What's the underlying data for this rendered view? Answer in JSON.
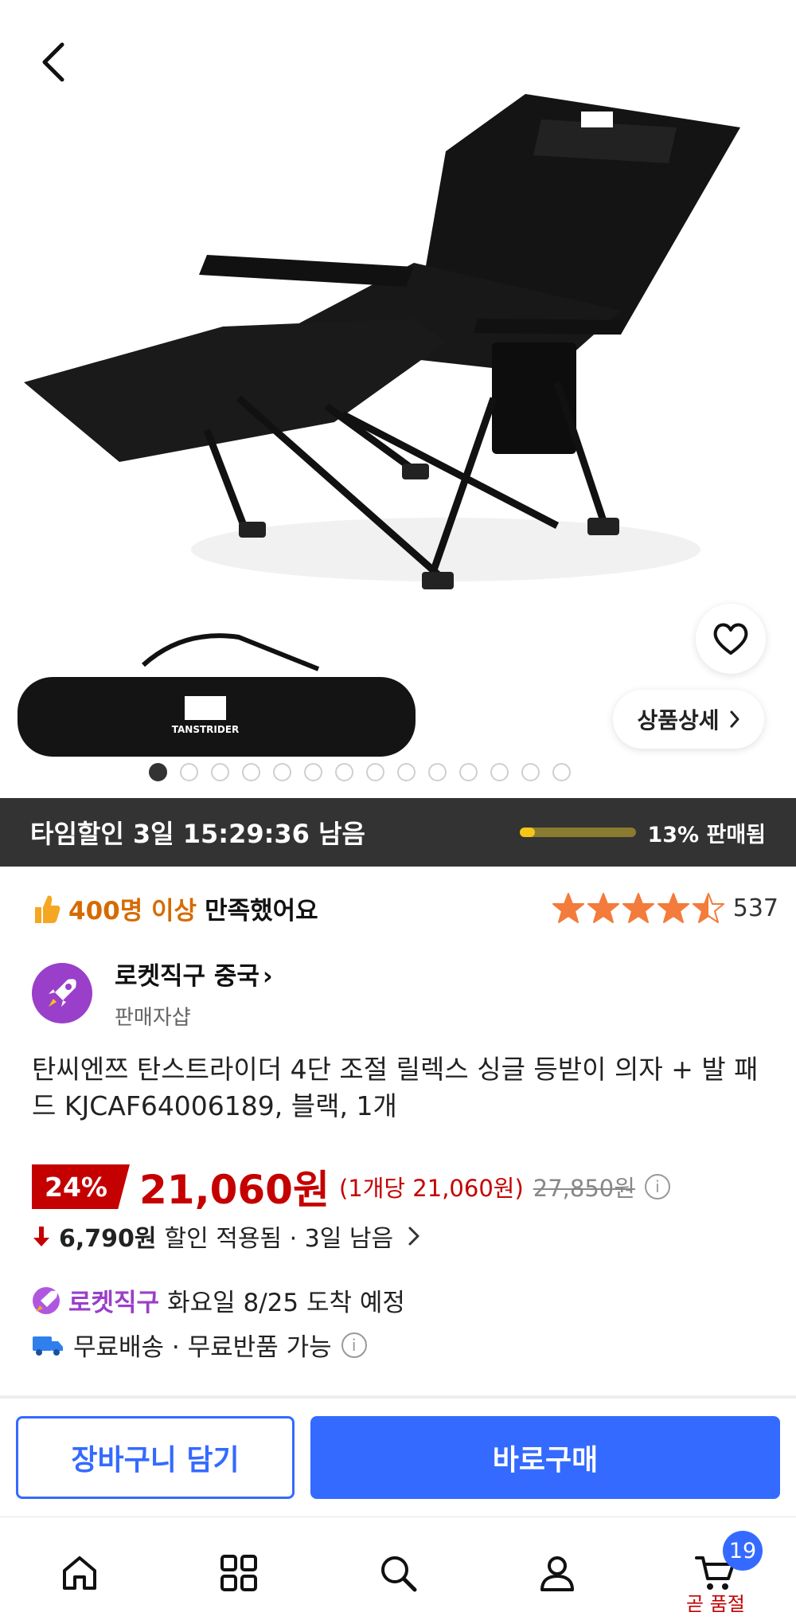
{
  "hero": {
    "product_logo_text": "TANSTRIDER",
    "detail_button_label": "상품상세",
    "image_count": 14,
    "active_image_index": 0
  },
  "timer": {
    "label": "타임할인 3일 15:29:36 남음",
    "sold_percent": 13,
    "sold_label": "13% 판매됨"
  },
  "satisfaction": {
    "highlight": "400명 이상",
    "suffix": "만족했어요",
    "rating": 4.5,
    "review_count": "537"
  },
  "seller": {
    "name": "로켓직구 중국",
    "chevron": "›",
    "subtitle": "판매자샵"
  },
  "product": {
    "title": "탄씨엔쯔 탄스트라이더 4단 조절 릴렉스 싱글 등받이 의자 + 발 패드 KJCAF64006189, 블랙, 1개"
  },
  "price": {
    "discount_badge": "24%",
    "price": "21,060원",
    "unit_price": "(1개당 21,060원)",
    "original_price": "27,850원"
  },
  "discount": {
    "amount": "6,790원",
    "text": "할인 적용됨 · 3일 남음"
  },
  "delivery": {
    "badge": "로켓직구",
    "text": "화요일 8/25 도착 예정",
    "shipping": "무료배송 · 무료반품 가능"
  },
  "actions": {
    "cart_label": "장바구니 담기",
    "buy_label": "바로구매"
  },
  "nav": {
    "cart_badge": "19",
    "soon_label": "곧 품절"
  },
  "colors": {
    "accent_blue": "#346aff",
    "price_red": "#c40000",
    "rocket_purple": "#9a3fc9",
    "timer_bg": "#333333",
    "progress_yellow": "#f5c518",
    "star_orange": "#f37b3b"
  }
}
